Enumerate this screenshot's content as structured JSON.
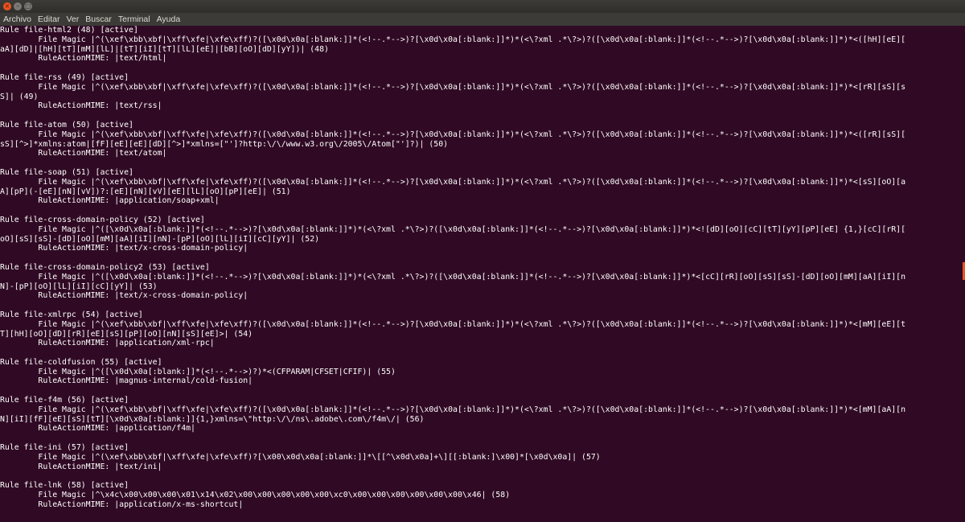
{
  "window": {
    "buttons": {
      "close": "×",
      "minimize": "–",
      "maximize": "□"
    }
  },
  "menubar": {
    "items": [
      "Archivo",
      "Editar",
      "Ver",
      "Buscar",
      "Terminal",
      "Ayuda"
    ]
  },
  "terminal": {
    "lines": [
      "Rule file-html2 (48) [active]",
      "        File Magic |^(\\xef\\xbb\\xbf|\\xff\\xfe|\\xfe\\xff)?([\\x0d\\x0a[:blank:]]*(<!--.*-->)?[\\x0d\\x0a[:blank:]]*)*(<\\?xml .*\\?>)?([\\x0d\\x0a[:blank:]]*(<!--.*-->)?[\\x0d\\x0a[:blank:]]*)*<([hH][eE][",
      "aA][dD]|[hH][tT][mM][lL]|[tT][iI][tT][lL][eE]|[bB][oO][dD][yY])| (48)",
      "        RuleActionMIME: |text/html|",
      "",
      "Rule file-rss (49) [active]",
      "        File Magic |^(\\xef\\xbb\\xbf|\\xff\\xfe|\\xfe\\xff)?([\\x0d\\x0a[:blank:]]*(<!--.*-->)?[\\x0d\\x0a[:blank:]]*)*(<\\?xml .*\\?>)?([\\x0d\\x0a[:blank:]]*(<!--.*-->)?[\\x0d\\x0a[:blank:]]*)*<[rR][sS][s",
      "S]| (49)",
      "        RuleActionMIME: |text/rss|",
      "",
      "Rule file-atom (50) [active]",
      "        File Magic |^(\\xef\\xbb\\xbf|\\xff\\xfe|\\xfe\\xff)?([\\x0d\\x0a[:blank:]]*(<!--.*-->)?[\\x0d\\x0a[:blank:]]*)*(<\\?xml .*\\?>)?([\\x0d\\x0a[:blank:]]*(<!--.*-->)?[\\x0d\\x0a[:blank:]]*)*<([rR][sS][",
      "sS][^>]*xmlns:atom|[fF][eE][eE][dD][^>]*xmlns=[\"']?http:\\/\\/www.w3.org\\/2005\\/Atom[\"']?)| (50)",
      "        RuleActionMIME: |text/atom|",
      "",
      "Rule file-soap (51) [active]",
      "        File Magic |^(\\xef\\xbb\\xbf|\\xff\\xfe|\\xfe\\xff)?([\\x0d\\x0a[:blank:]]*(<!--.*-->)?[\\x0d\\x0a[:blank:]]*)*(<\\?xml .*\\?>)?([\\x0d\\x0a[:blank:]]*(<!--.*-->)?[\\x0d\\x0a[:blank:]]*)*<[sS][oO][a",
      "A][pP](-[eE][nN][vV])?:[eE][nN][vV][eE][lL][oO][pP][eE]| (51)",
      "        RuleActionMIME: |application/soap+xml|",
      "",
      "Rule file-cross-domain-policy (52) [active]",
      "        File Magic |^([\\x0d\\x0a[:blank:]]*(<!--.*-->)?[\\x0d\\x0a[:blank:]]*)*(<\\?xml .*\\?>)?([\\x0d\\x0a[:blank:]]*(<!--.*-->)?[\\x0d\\x0a[:blank:]]*)*<![dD][oO][cC][tT][yY][pP][eE] {1,}[cC][rR][",
      "oO][sS][sS]-[dD][oO][mM][aA][iI][nN]-[pP][oO][lL][iI][cC][yY]| (52)",
      "        RuleActionMIME: |text/x-cross-domain-policy|",
      "",
      "Rule file-cross-domain-policy2 (53) [active]",
      "        File Magic |^([\\x0d\\x0a[:blank:]]*(<!--.*-->)?[\\x0d\\x0a[:blank:]]*)*(<\\?xml .*\\?>)?([\\x0d\\x0a[:blank:]]*(<!--.*-->)?[\\x0d\\x0a[:blank:]]*)*<[cC][rR][oO][sS][sS]-[dD][oO][mM][aA][iI][n",
      "N]-[pP][oO][lL][iI][cC][yY]| (53)",
      "        RuleActionMIME: |text/x-cross-domain-policy|",
      "",
      "Rule file-xmlrpc (54) [active]",
      "        File Magic |^(\\xef\\xbb\\xbf|\\xff\\xfe|\\xfe\\xff)?([\\x0d\\x0a[:blank:]]*(<!--.*-->)?[\\x0d\\x0a[:blank:]]*)*(<\\?xml .*\\?>)?([\\x0d\\x0a[:blank:]]*(<!--.*-->)?[\\x0d\\x0a[:blank:]]*)*<[mM][eE][t",
      "T][hH][oO][dD][rR][eE][sS][pP][oO][nN][sS][eE]>| (54)",
      "        RuleActionMIME: |application/xml-rpc|",
      "",
      "Rule file-coldfusion (55) [active]",
      "        File Magic |^([\\x0d\\x0a[:blank:]]*(<!--.*-->)?)*<(CFPARAM|CFSET|CFIF)| (55)",
      "        RuleActionMIME: |magnus-internal/cold-fusion|",
      "",
      "Rule file-f4m (56) [active]",
      "        File Magic |^(\\xef\\xbb\\xbf|\\xff\\xfe|\\xfe\\xff)?([\\x0d\\x0a[:blank:]]*(<!--.*-->)?[\\x0d\\x0a[:blank:]]*)*(<\\?xml .*\\?>)?([\\x0d\\x0a[:blank:]]*(<!--.*-->)?[\\x0d\\x0a[:blank:]]*)*<[mM][aA][n",
      "N][iI][fF][eE][sS][tT][\\x0d\\x0a[:blank:]]{1,}xmlns=\\\"http:\\/\\/ns\\.adobe\\.com\\/f4m\\/| (56)",
      "        RuleActionMIME: |application/f4m|",
      "",
      "Rule file-ini (57) [active]",
      "        File Magic |^(\\xef\\xbb\\xbf|\\xff\\xfe|\\xfe\\xff)?[\\x00\\x0d\\x0a[:blank:]]*\\[[^\\x0d\\x0a]+\\][[:blank:]\\x00]*[\\x0d\\x0a]| (57)",
      "        RuleActionMIME: |text/ini|",
      "",
      "Rule file-lnk (58) [active]",
      "        File Magic |^\\x4c\\x00\\x00\\x00\\x01\\x14\\x02\\x00\\x00\\x00\\x00\\x00\\xc0\\x00\\x00\\x00\\x00\\x00\\x00\\x46| (58)",
      "        RuleActionMIME: |application/x-ms-shortcut|"
    ]
  }
}
